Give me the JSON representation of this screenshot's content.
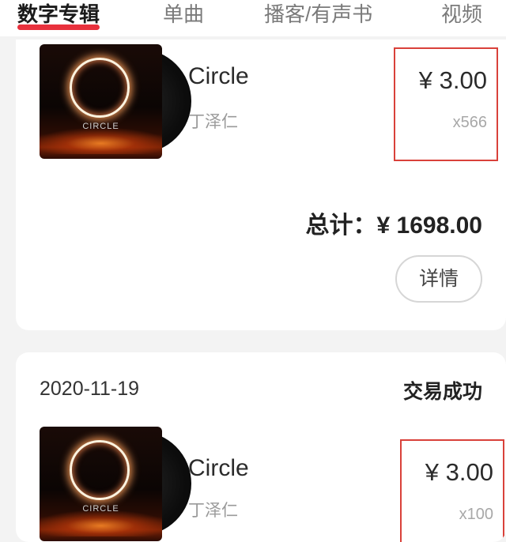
{
  "tabs": [
    {
      "label": "数字专辑",
      "active": true
    },
    {
      "label": "单曲",
      "active": false
    },
    {
      "label": "播客/有声书",
      "active": false
    },
    {
      "label": "视频",
      "active": false
    }
  ],
  "colors": {
    "accent": "#e8313d",
    "highlight_box": "#d9413a"
  },
  "orders": [
    {
      "item": {
        "cover_text": "CIRCLE",
        "title": "Circle",
        "artist": "丁泽仁",
        "price": "¥ 3.00",
        "quantity": "x566"
      },
      "total": "总计：¥ 1698.00",
      "detail_button": "详情"
    },
    {
      "date": "2020-11-19",
      "status": "交易成功",
      "item": {
        "cover_text": "CIRCLE",
        "title": "Circle",
        "artist": "丁泽仁",
        "price": "¥ 3.00",
        "quantity": "x100"
      }
    }
  ]
}
